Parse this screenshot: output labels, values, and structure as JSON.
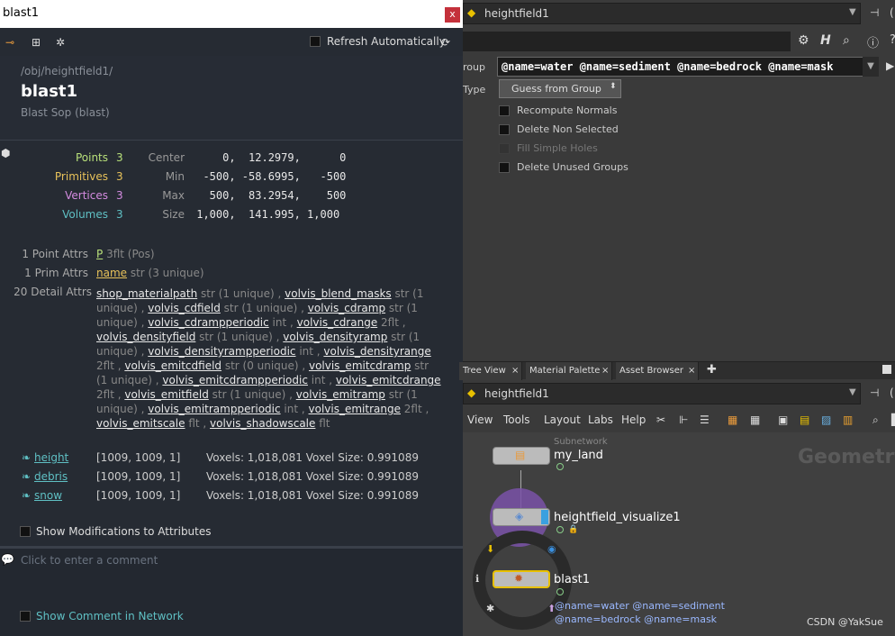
{
  "info": {
    "window_title": "blast1",
    "close": "x",
    "refresh_label": "Refresh Automatically",
    "path": "/obj/heightfield1/",
    "node_name": "blast1",
    "node_type": "Blast Sop (blast)",
    "stats": {
      "points_label": "Points",
      "points": "3",
      "prims_label": "Primitives",
      "prims": "3",
      "verts_label": "Vertices",
      "verts": "3",
      "vols_label": "Volumes",
      "vols": "3",
      "center_label": "Center",
      "center": "     0,  12.2979,      0",
      "min_label": "Min",
      "min": "  -500, -58.6995,   -500",
      "max_label": "Max",
      "max": "   500,  83.2954,    500",
      "size_label": "Size",
      "size": " 1,000,  141.995, 1,000"
    },
    "attrs": {
      "point_label": "1 Point Attrs",
      "point_name": "P",
      "point_meta": " 3flt (Pos)",
      "prim_label": "1 Prim Attrs",
      "prim_name": "name",
      "prim_meta": " str (3 unique)",
      "detail_label": "20 Detail Attrs",
      "detail_items": [
        {
          "name": "shop_materialpath",
          "meta": " str (1 unique) , "
        },
        {
          "name": "volvis_blend_masks",
          "meta": " str (1 unique) , "
        },
        {
          "name": "volvis_cdfield",
          "meta": " str (1 unique) , "
        },
        {
          "name": "volvis_cdramp",
          "meta": " str (1 unique) , "
        },
        {
          "name": "volvis_cdrampperiodic",
          "meta": " int , "
        },
        {
          "name": "volvis_cdrange",
          "meta": " 2flt , "
        },
        {
          "name": "volvis_densityfield",
          "meta": " str (1 unique) , "
        },
        {
          "name": "volvis_densityramp",
          "meta": " str (1 unique) , "
        },
        {
          "name": "volvis_densityrampperiodic",
          "meta": " int , "
        },
        {
          "name": "volvis_densityrange",
          "meta": " 2flt , "
        },
        {
          "name": "volvis_emitcdfield",
          "meta": " str (0 unique) , "
        },
        {
          "name": "volvis_emitcdramp",
          "meta": " str (1 unique) , "
        },
        {
          "name": "volvis_emitcdrampperiodic",
          "meta": " int , "
        },
        {
          "name": "volvis_emitcdrange",
          "meta": " 2flt , "
        },
        {
          "name": "volvis_emitfield",
          "meta": " str (1 unique) , "
        },
        {
          "name": "volvis_emitramp",
          "meta": " str (1 unique) , "
        },
        {
          "name": "volvis_emitrampperiodic",
          "meta": " int , "
        },
        {
          "name": "volvis_emitrange",
          "meta": " 2flt , "
        },
        {
          "name": "volvis_emitscale",
          "meta": " flt , "
        },
        {
          "name": "volvis_shadowscale",
          "meta": " flt"
        }
      ]
    },
    "volumes": [
      {
        "name": "height",
        "dims": "[1009, 1009, 1]",
        "voxels": "Voxels: 1,018,081 Voxel Size: 0.991089"
      },
      {
        "name": "debris",
        "dims": "[1009, 1009, 1]",
        "voxels": "Voxels: 1,018,081 Voxel Size: 0.991089"
      },
      {
        "name": "snow",
        "dims": "[1009, 1009, 1]",
        "voxels": "Voxels: 1,018,081 Voxel Size: 0.991089"
      }
    ],
    "show_mods": "Show Modifications to Attributes",
    "comment_placeholder": "Click to enter a comment",
    "show_comment": "Show Comment in Network"
  },
  "params": {
    "path": "heightfield1",
    "group_label": "roup",
    "group_value": "@name=water @name=sediment @name=bedrock @name=mask",
    "type_label": "Type",
    "type_value": "Guess from Group",
    "recompute": "Recompute Normals",
    "delete_nonsel": "Delete Non Selected",
    "fill_holes": "Fill Simple Holes",
    "delete_groups": "Delete Unused Groups"
  },
  "tabs": [
    "Tree View",
    "Material Palette",
    "Asset Browser"
  ],
  "network": {
    "path": "heightfield1",
    "menus": [
      "View",
      "Tools",
      "Layout",
      "Labs",
      "Help"
    ],
    "context_label": "Geometry",
    "subnet_label": "Subnetwork",
    "nodes": [
      "my_land",
      "heightfield_visualize1",
      "blast1"
    ],
    "blast_group_line1": "@name=water @name=sediment",
    "blast_group_line2": "@name=bedrock @name=mask",
    "watermark": "CSDN @YakSue"
  },
  "colors": {
    "points": "#b8e07a",
    "prims": "#e8c25a",
    "verts": "#d48be0",
    "vols": "#5fc0c4",
    "accent": "#e8c000"
  }
}
